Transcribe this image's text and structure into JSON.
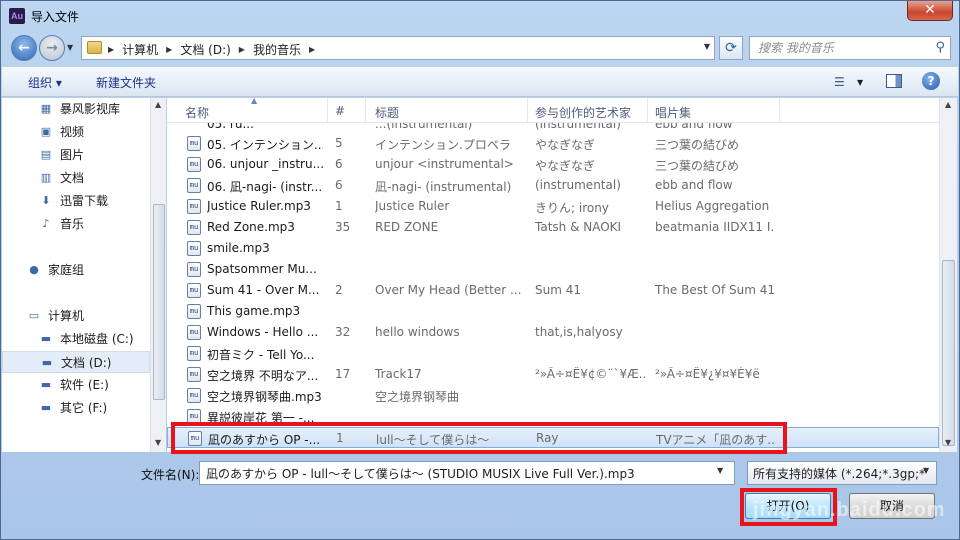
{
  "window": {
    "title": "导入文件",
    "app_icon_text": "Au",
    "close_label": "✕"
  },
  "nav": {
    "breadcrumbs": [
      "计算机",
      "文档 (D:)",
      "我的音乐"
    ],
    "search_placeholder": "搜索 我的音乐"
  },
  "toolbar": {
    "organize": "组织 ▾",
    "new_folder": "新建文件夹"
  },
  "sidebar": {
    "items": [
      {
        "label": "暴风影视库",
        "icon": "video-library-icon"
      },
      {
        "label": "视频",
        "icon": "video-icon"
      },
      {
        "label": "图片",
        "icon": "picture-icon"
      },
      {
        "label": "文档",
        "icon": "document-icon"
      },
      {
        "label": "迅雷下载",
        "icon": "download-icon"
      },
      {
        "label": "音乐",
        "icon": "music-icon"
      },
      {
        "label": "家庭组",
        "icon": "homegroup-icon"
      },
      {
        "label": "计算机",
        "icon": "computer-icon"
      },
      {
        "label": "本地磁盘 (C:)",
        "icon": "system-drive-icon"
      },
      {
        "label": "文档 (D:)",
        "icon": "drive-icon"
      },
      {
        "label": "软件 (E:)",
        "icon": "drive-icon"
      },
      {
        "label": "其它 (F:)",
        "icon": "drive-icon"
      }
    ],
    "selected": "文档 (D:)"
  },
  "columns": [
    "名称",
    "#",
    "标题",
    "参与创作的艺术家",
    "唱片集"
  ],
  "files": [
    {
      "name": "05. インテンション...",
      "num": "5",
      "title": "インテンション.プロペラ",
      "artist": "やなぎなぎ",
      "album": "三つ葉の結びめ"
    },
    {
      "name": "06. unjour _instru...",
      "num": "6",
      "title": "unjour <instrumental>",
      "artist": "やなぎなぎ",
      "album": "三つ葉の結びめ"
    },
    {
      "name": "06. 凪-nagi- (instr...",
      "num": "6",
      "title": "凪-nagi- (instrumental)",
      "artist": "(instrumental)",
      "album": "ebb and flow"
    },
    {
      "name": "Justice Ruler.mp3",
      "num": "1",
      "title": "Justice Ruler",
      "artist": "きりん; irony",
      "album": "Helius Aggregation"
    },
    {
      "name": "Red Zone.mp3",
      "num": "35",
      "title": "RED ZONE",
      "artist": "Tatsh & NAOKI",
      "album": "beatmania IIDX11 I..."
    },
    {
      "name": "smile.mp3",
      "num": "",
      "title": "",
      "artist": "",
      "album": ""
    },
    {
      "name": "Spatsommer Mu...",
      "num": "",
      "title": "",
      "artist": "",
      "album": ""
    },
    {
      "name": "Sum 41 - Over M...",
      "num": "2",
      "title": "Over My Head (Better ...",
      "artist": "Sum 41",
      "album": "The Best Of Sum 41"
    },
    {
      "name": "This game.mp3",
      "num": "",
      "title": "",
      "artist": "",
      "album": ""
    },
    {
      "name": "Windows - Hello ...",
      "num": "32",
      "title": "hello windows",
      "artist": "that,is,halyosy",
      "album": ""
    },
    {
      "name": "初音ミク - Tell Yo...",
      "num": "",
      "title": "",
      "artist": "",
      "album": ""
    },
    {
      "name": "空之境界 不明なア...",
      "num": "17",
      "title": "Track17",
      "artist": "²»Ã÷¤Ê¥¢©¨`¥Æ...",
      "album": "²»Ã÷¤Ê¥¿¥¤¥È¥ë"
    },
    {
      "name": "空之境界钢琴曲.mp3",
      "num": "",
      "title": "空之境界钢琴曲",
      "artist": "",
      "album": ""
    },
    {
      "name": "異説彼岸花 第一 -...",
      "num": "",
      "title": "",
      "artist": "",
      "album": ""
    },
    {
      "name": "凪のあすから OP -...",
      "num": "1",
      "title": "lull～そして僕らは～",
      "artist": "Ray",
      "album": "TVアニメ「凪のあす..."
    }
  ],
  "top_partial_row": {
    "name": "05. ru...",
    "title": "...(instrumental)",
    "artist": "(instrumental)",
    "album": "ebb and flow"
  },
  "selected_file_index": 14,
  "file_icon_text": "mu",
  "footer": {
    "filename_label": "文件名(N):",
    "filename_value": "凪のあすから OP - lull～そして僕らは～ (STUDIO MUSIX Live Full Ver.).mp3",
    "filetype_value": "所有支持的媒体 (*.264;*.3gp;*",
    "open_label": "打开(O)",
    "cancel_label": "取消"
  },
  "watermark": "jingyan.baidu.com",
  "highlight_color": "#e8141c"
}
